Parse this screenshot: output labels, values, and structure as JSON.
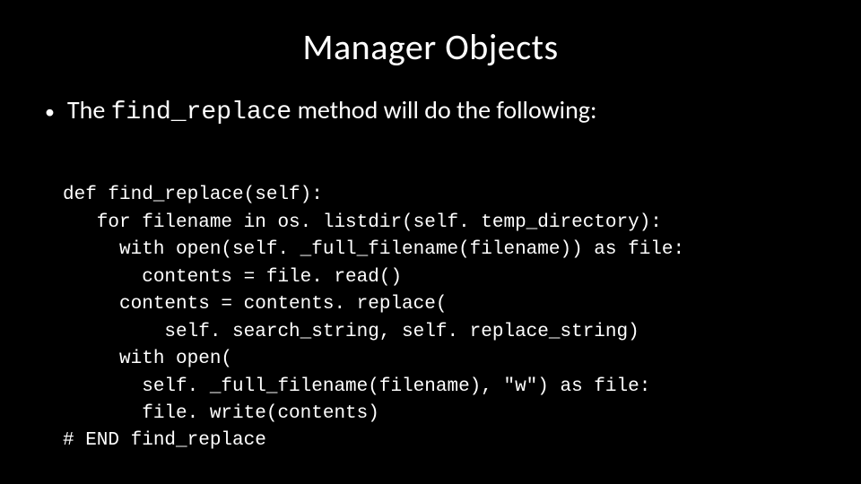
{
  "title": "Manager Objects",
  "bullet": {
    "pre": "The ",
    "code": "find_replace",
    "post": " method will do the following:"
  },
  "code": [
    "def find_replace(self):",
    "   for filename in os. listdir(self. temp_directory):",
    "     with open(self. _full_filename(filename)) as file:",
    "       contents = file. read()",
    "     contents = contents. replace(",
    "         self. search_string, self. replace_string)",
    "     with open(",
    "       self. _full_filename(filename), \"w\") as file:",
    "       file. write(contents)",
    "# END find_replace"
  ]
}
